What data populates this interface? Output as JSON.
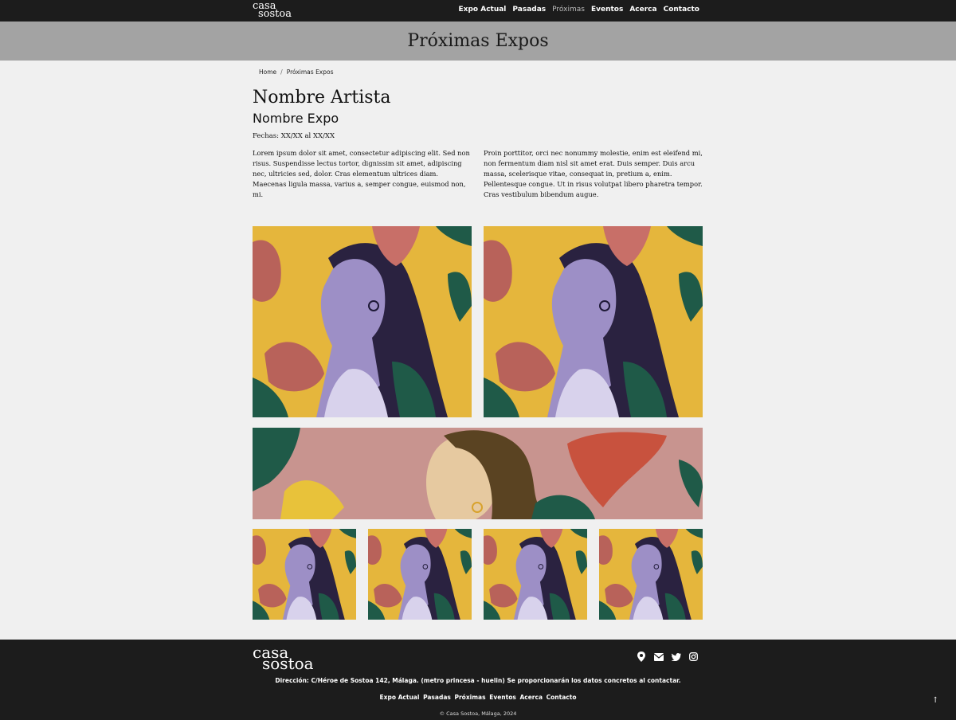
{
  "header": {
    "logo_line1": "casa",
    "logo_line2": "sostoa",
    "nav": [
      "Expo Actual",
      "Pasadas",
      "Próximas",
      "Eventos",
      "Acerca",
      "Contacto"
    ],
    "active_nav": "Próximas"
  },
  "banner": {
    "title": "Próximas Expos"
  },
  "breadcrumb": {
    "home": "Home",
    "separator": "/",
    "current": "Próximas Expos"
  },
  "content": {
    "artist": "Nombre Artista",
    "expo": "Nombre Expo",
    "dates": "Fechas: XX/XX al XX/XX",
    "col1": "Lorem ipsum dolor sit amet, consectetur adipiscing elit. Sed non risus. Suspendisse lectus tortor, dignissim sit amet, adipiscing nec, ultricies sed, dolor. Cras elementum ultrices diam. Maecenas ligula massa, varius a, semper congue, euismod non, mi.",
    "col2": "Proin porttitor, orci nec nonummy molestie, enim est eleifend mi, non fermentum diam nisl sit amet erat. Duis semper. Duis arcu massa, scelerisque vitae, consequat in, pretium a, enim. Pellentesque congue. Ut in risus volutpat libero pharetra tempor. Cras vestibulum bibendum augue."
  },
  "colors": {
    "yellow": "#e5b63c",
    "purple_skin": "#9d8fc6",
    "hair": "#2a2240",
    "flower": "#b8625a",
    "leaf": "#1f5a48",
    "pink_bg": "#c8948f",
    "skin": "#e6c9a0",
    "dark": "#1c1c1c"
  },
  "footer": {
    "logo_line1": "casa",
    "logo_line2": "sostoa",
    "address": "Dirección: C/Héroe de Sostoa 142, Málaga. (metro princesa - huelin) Se proporcionarán los datos concretos al contactar.",
    "nav": [
      "Expo Actual",
      "Pasadas",
      "Próximas",
      "Eventos",
      "Acerca",
      "Contacto"
    ],
    "copyright": "© Casa Sostoa, Málaga, 2024",
    "icons": [
      "map-marker-icon",
      "envelope-icon",
      "twitter-icon",
      "instagram-icon"
    ],
    "back_to_top": "↑"
  }
}
